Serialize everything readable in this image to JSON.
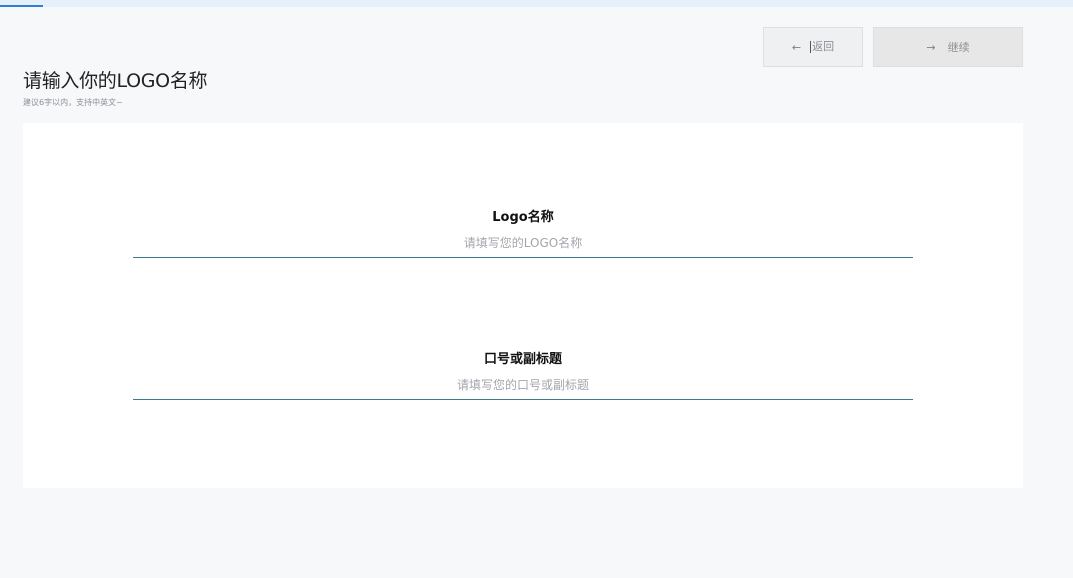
{
  "progress": {
    "value": 0.04
  },
  "nav": {
    "back_icon": "←",
    "back_label": "返回",
    "next_icon": "→",
    "next_label": "继续"
  },
  "header": {
    "title": "请输入你的LOGO名称",
    "subtitle": "建议6字以内，支持中英文~"
  },
  "form": {
    "logo_name": {
      "label": "Logo名称",
      "value": "",
      "placeholder": "请填写您的LOGO名称"
    },
    "slogan": {
      "label": "口号或副标题",
      "value": "",
      "placeholder": "请填写您的口号或副标题"
    }
  },
  "colors": {
    "accent": "#2f7fd8",
    "input_underline": "#3f7a8a",
    "background": "#f7f8fa",
    "card": "#ffffff"
  }
}
